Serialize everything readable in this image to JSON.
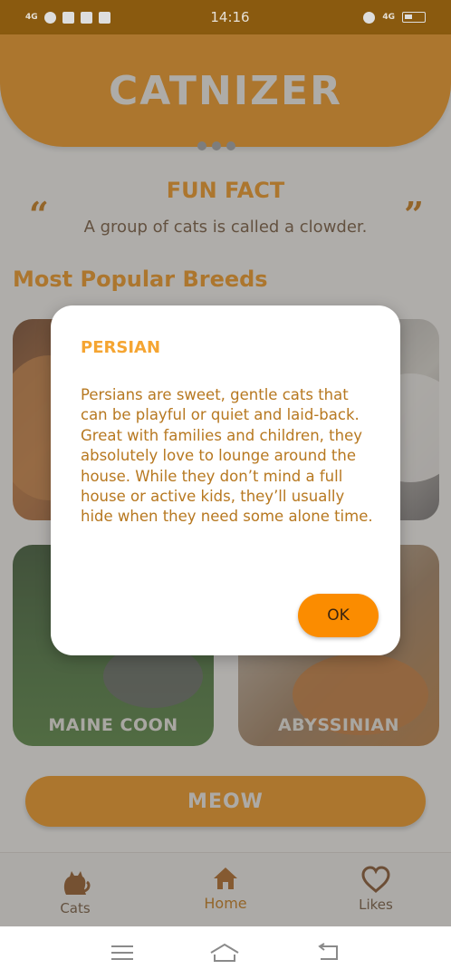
{
  "status_bar": {
    "time": "14:16",
    "signal": "4G",
    "network_right": "4G"
  },
  "app": {
    "logo": "CATNIZER"
  },
  "fun_fact": {
    "title": "FUN FACT",
    "text": "A group of cats is called a clowder.",
    "quote_open": "“",
    "quote_close": "”"
  },
  "section": {
    "title": "Most Popular Breeds"
  },
  "breeds": [
    {
      "label": "",
      "colors": "#b86a2c"
    },
    {
      "label": "",
      "colors": "#d7d2c8"
    },
    {
      "label": "MAINE COON",
      "colors": "#3f6a2c"
    },
    {
      "label": "ABYSSINIAN",
      "colors": "#b8742e"
    }
  ],
  "meow_button": {
    "label": "MEOW"
  },
  "bottom_nav": {
    "items": [
      {
        "label": "Cats",
        "icon": "cat-icon"
      },
      {
        "label": "Home",
        "icon": "home-icon"
      },
      {
        "label": "Likes",
        "icon": "heart-icon"
      }
    ],
    "active": "Home"
  },
  "dialog": {
    "title": "PERSIAN",
    "body": "Persians are sweet, gentle cats that can be playful or quiet and laid-back. Great with families and children, they absolutely love to lounge around the house. While they don’t mind a full house or active kids, they’ll usually hide when they need some alone time.",
    "ok_label": "OK"
  },
  "colors": {
    "accent": "#ee8c0a",
    "dialog_title": "#f5a532",
    "dialog_text": "#b77820",
    "ok_button": "#fb8c00"
  }
}
